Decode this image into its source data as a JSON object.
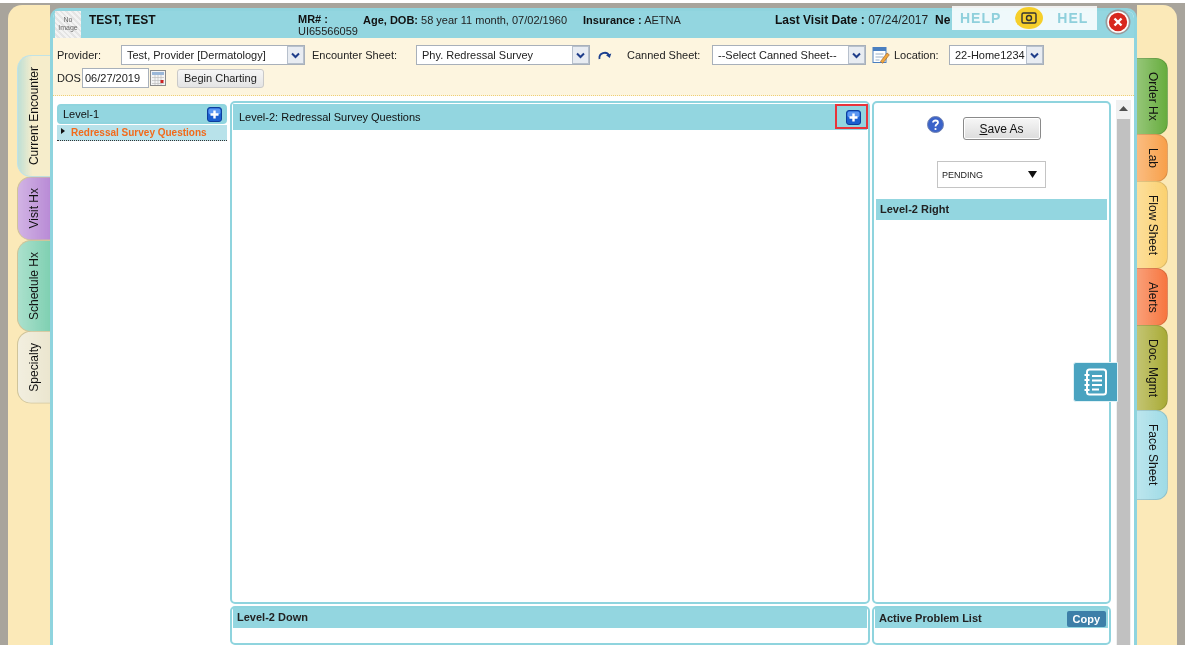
{
  "left_tabs": [
    {
      "label": "Current Encounter",
      "selected": true,
      "color": "#f6edcb"
    },
    {
      "label": "Visit Hx",
      "selected": false,
      "color": "#b98bd6"
    },
    {
      "label": "Schedule Hx",
      "selected": false,
      "color": "#7fd0b2"
    },
    {
      "label": "Specialty",
      "selected": false,
      "color": "#ebe6cf"
    }
  ],
  "patient_header": {
    "photo": "No Image",
    "name": "TEST, TEST",
    "fields": [
      {
        "label": "MR# :",
        "value": "UI65566059"
      },
      {
        "label": "Age, DOB:",
        "value": "58 year 11 month, 07/02/1960"
      },
      {
        "label": "Insurance :",
        "value": "AETNA"
      },
      {
        "label": "Last Visit Date :",
        "value": "07/24/2017"
      },
      {
        "label": "Ne"
      }
    ]
  },
  "help_overlay": {
    "labels": [
      "HELP",
      "HEL"
    ]
  },
  "toolbar": {
    "provider": {
      "label": "Provider:",
      "value": "Test, Provider [Dermatology]"
    },
    "encounter_sheet": {
      "label": "Encounter Sheet:",
      "value": "Phy. Redressal Survey"
    },
    "canned_sheet": {
      "label": "Canned Sheet:",
      "value": "--Select Canned Sheet--"
    },
    "location": {
      "label": "Location:",
      "value": "22-Home1234"
    },
    "dos": {
      "label": "DOS",
      "value": "06/27/2019"
    },
    "begin_button": "Begin Charting"
  },
  "level_1": {
    "title": "Level-1",
    "items": [
      {
        "label": "Redressal Survey Questions",
        "selected": true
      }
    ]
  },
  "level_2": {
    "title": "Level-2: Redressal Survey Questions",
    "add_button": {
      "highlighted": true
    }
  },
  "right_panel": {
    "save_button": "Save As",
    "status": {
      "value": "PENDING"
    },
    "section_title": "Level-2 Right"
  },
  "bottom_panels": {
    "level_2_down": {
      "title": "Level-2 Down"
    },
    "problem_list": {
      "title": "Active Problem List",
      "button": "Copy"
    }
  },
  "right_tabs": [
    {
      "label": "Order Hx",
      "selected": false,
      "color": "#67ad3e"
    },
    {
      "label": "Lab",
      "selected": false,
      "color": "#f8a04a"
    },
    {
      "label": "Flow Sheet",
      "selected": false,
      "color": "#fbd170"
    },
    {
      "label": "Alerts",
      "selected": false,
      "color": "#f7763f"
    },
    {
      "label": "Doc. Mgmt",
      "selected": false,
      "color": "#a9ab36"
    },
    {
      "label": "Face Sheet",
      "selected": false,
      "color": "#9fdbe6"
    }
  ]
}
